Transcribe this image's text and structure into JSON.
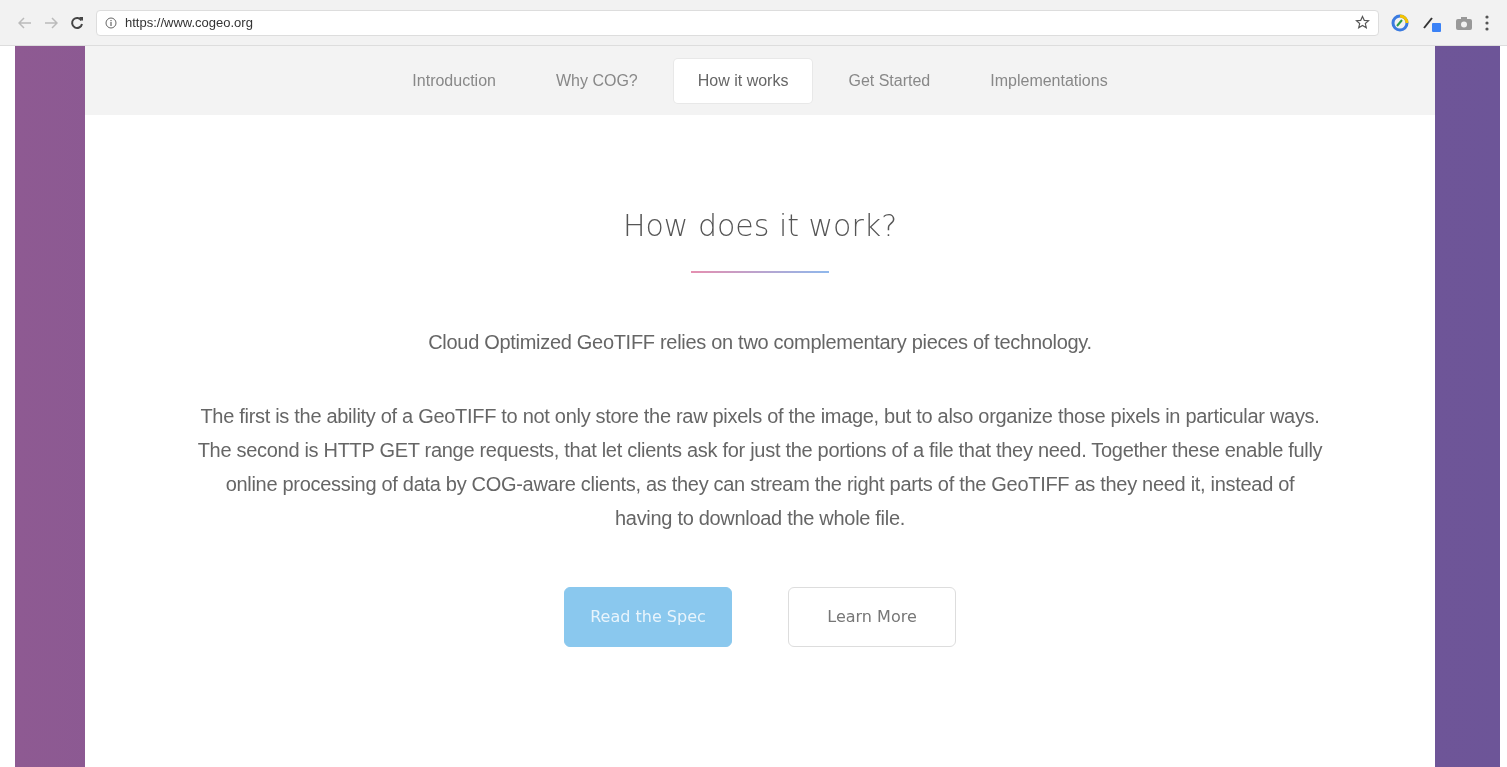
{
  "browser": {
    "url": "https://www.cogeo.org"
  },
  "nav": {
    "items": [
      {
        "label": "Introduction",
        "selected": false
      },
      {
        "label": "Why COG?",
        "selected": false
      },
      {
        "label": "How it works",
        "selected": true
      },
      {
        "label": "Get Started",
        "selected": false
      },
      {
        "label": "Implementations",
        "selected": false
      }
    ]
  },
  "section": {
    "title": "How does it work?",
    "paragraphs": [
      "Cloud Optimized GeoTIFF relies on two complementary pieces of technology.",
      "The first is the ability of a GeoTIFF to not only store the raw pixels of the image, but to also organize those pixels in particular ways. The second is HTTP GET range requests, that let clients ask for just the portions of a file that they need. Together these enable fully online processing of data by COG-aware clients, as they can stream the right parts of the GeoTIFF as they need it, instead of having to download the whole file."
    ],
    "buttons": [
      {
        "label": "Read the Spec",
        "kind": "primary"
      },
      {
        "label": "Learn More",
        "kind": "secondary"
      }
    ]
  }
}
